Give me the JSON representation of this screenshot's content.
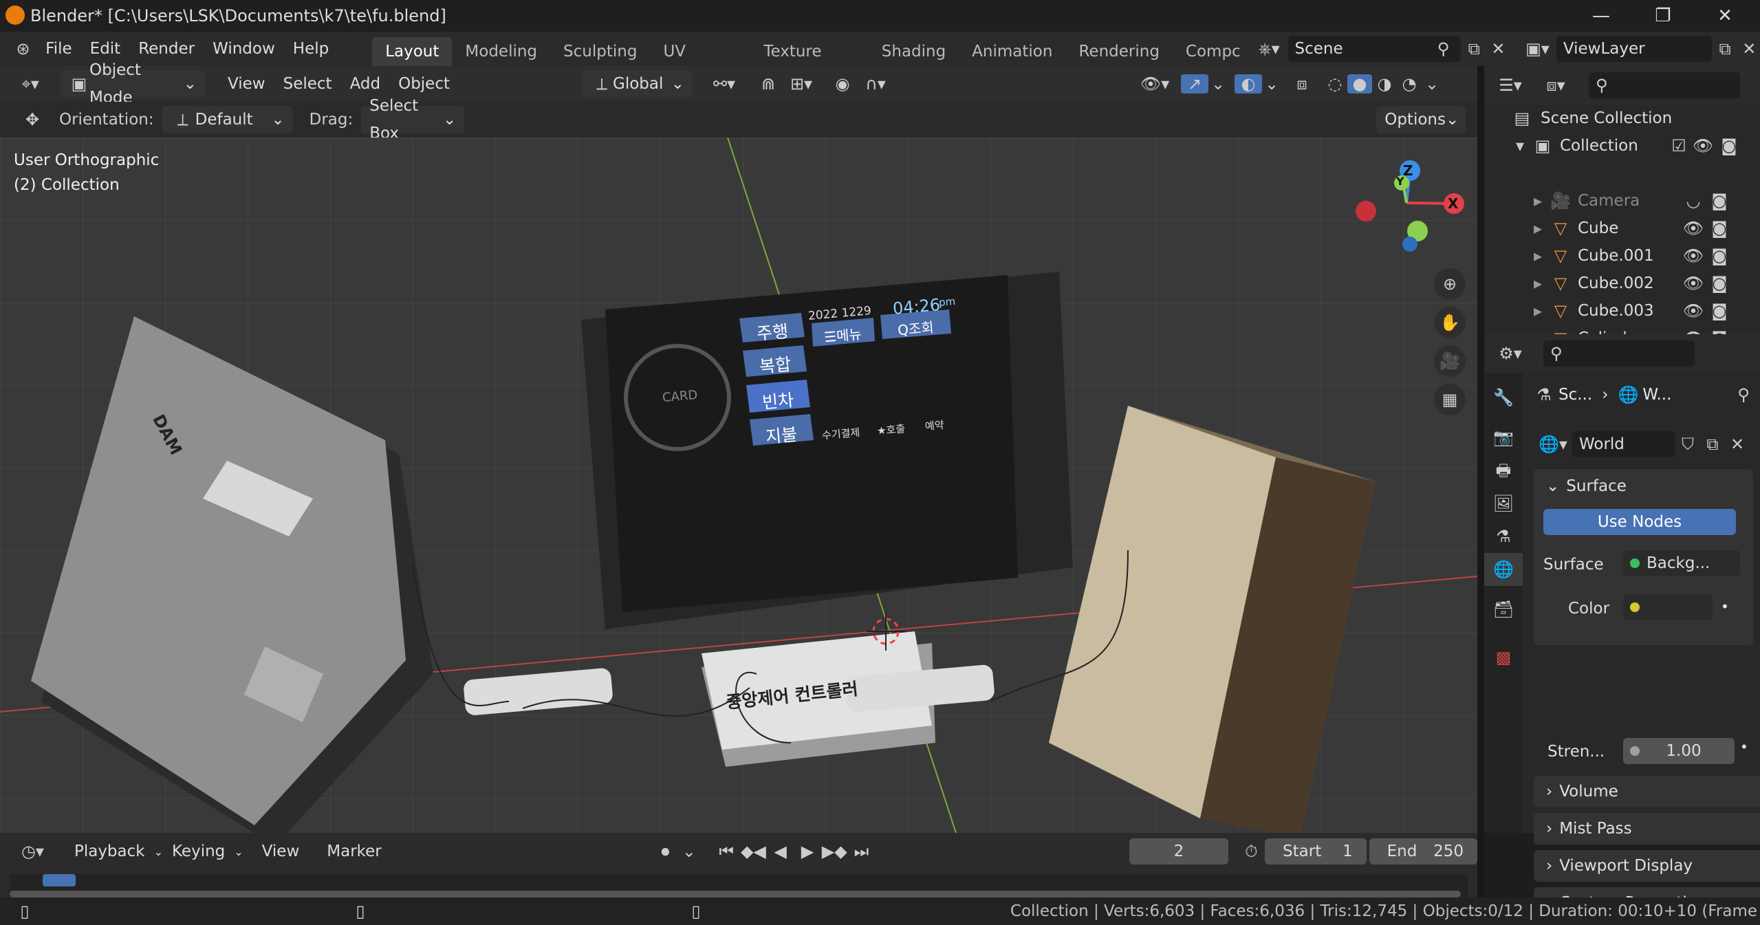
{
  "titlebar": {
    "title": "Blender* [C:\\Users\\LSK\\Documents\\k7\\te\\fu.blend]"
  },
  "menubar": {
    "menus": [
      "File",
      "Edit",
      "Render",
      "Window",
      "Help"
    ],
    "workspaces": [
      "Layout",
      "Modeling",
      "Sculpting",
      "UV Editing",
      "Texture Paint",
      "Shading",
      "Animation",
      "Rendering",
      "Compc"
    ],
    "scene": "Scene",
    "view_layer": "ViewLayer"
  },
  "viewport_header": {
    "mode": "Object Mode",
    "menus": [
      "View",
      "Select",
      "Add",
      "Object"
    ],
    "transform": "Global"
  },
  "tool_settings": {
    "orientation_label": "Orientation:",
    "orientation_value": "Default",
    "drag_label": "Drag:",
    "drag_value": "Select Box",
    "options": "Options"
  },
  "viewport": {
    "view_name": "User Orthographic",
    "collection": "(2) Collection",
    "gizmo_axes": [
      "Z",
      "Y",
      "X"
    ],
    "scene_text": {
      "controller": "중앙제어 컨트롤러",
      "screen_date": "2022  1229",
      "screen_time": "04:26",
      "screen_ampm": "pm",
      "screen_buttons": [
        "주행",
        "복합",
        "빈차",
        "지불"
      ],
      "screen_menu": "☰메뉴",
      "screen_lookup": "Q조회",
      "screen_bottom": [
        "수기결제",
        "★호출",
        "예약"
      ],
      "card": "CARD",
      "ecu_label": "DAM"
    }
  },
  "outliner": {
    "scene_collection": "Scene Collection",
    "collection": "Collection",
    "items": [
      {
        "name": "Camera",
        "dim": true
      },
      {
        "name": "Cube",
        "dim": false
      },
      {
        "name": "Cube.001",
        "dim": false
      },
      {
        "name": "Cube.002",
        "dim": false
      },
      {
        "name": "Cube.003",
        "dim": false
      },
      {
        "name": "Cylinder",
        "dim": false
      }
    ]
  },
  "properties": {
    "breadcrumb": [
      "Sc...",
      "W..."
    ],
    "world_name": "World",
    "surface_panel": "Surface",
    "use_nodes": "Use Nodes",
    "surface_label": "Surface",
    "surface_value": "Backg...",
    "color_label": "Color",
    "strength_label": "Stren...",
    "strength_value": "1.00",
    "panels": [
      "Volume",
      "Mist Pass",
      "Viewport Display",
      "Custom Properties"
    ]
  },
  "timeline": {
    "menus": [
      "Playback",
      "Keying",
      "View",
      "Marker"
    ],
    "current_frame": "2",
    "start_label": "Start",
    "start_value": "1",
    "end_label": "End",
    "end_value": "250"
  },
  "status": {
    "text": "Collection | Verts:6,603 | Faces:6,036 | Tris:12,745 | Objects:0/12 | Duration: 00:10+10 (Frame"
  },
  "colors": {
    "accent": "#4772b3",
    "active_tab": "#3d3d3d",
    "x_axis": "#e2404a",
    "y_axis": "#8bd150",
    "z_axis": "#3d8fe6"
  }
}
